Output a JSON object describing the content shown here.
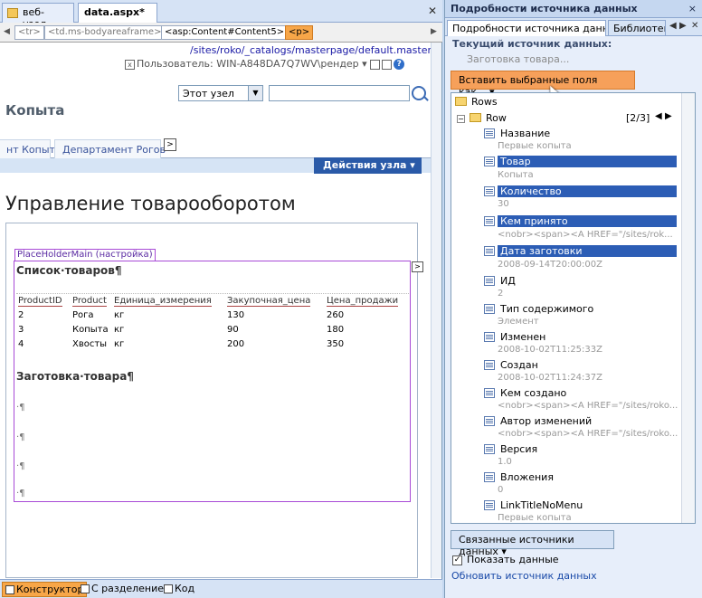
{
  "doc_tabs": [
    {
      "label": "веб-узел",
      "active": false
    },
    {
      "label": "data.aspx*",
      "active": true
    }
  ],
  "tag_bar": {
    "items": [
      "<tr>",
      "<td.ms-bodyareaframe>",
      "<asp:Content#Content5>",
      "<p>"
    ]
  },
  "design": {
    "path": "/sites/roko/_catalogs/masterpage/default.master",
    "user_text": "Пользователь: WIN-A848DA7Q7WV\\рендер ▾",
    "site_title": "Копыта",
    "scope_select": "Этот узел",
    "search_value": "",
    "nav_items": [
      "нт Копыт",
      "Департамент Рогов"
    ],
    "site_actions": "Действия узла ▾",
    "page_title": "Управление товарооборотом",
    "placeholder_label": "PlaceHolderMain (настройка)",
    "list_heading": "Список·товаров¶",
    "table_headers": [
      "ProductID",
      "Product",
      "Единица_измерения",
      "Закупочная_цена",
      "Цена_продажи"
    ],
    "table_rows": [
      [
        "2",
        "Рога",
        "кг",
        "130",
        "260"
      ],
      [
        "3",
        "Копыта",
        "кг",
        "90",
        "180"
      ],
      [
        "4",
        "Хвосты",
        "кг",
        "200",
        "350"
      ]
    ],
    "section_heading": "Заготовка·товара¶",
    "paragraph_marks": [
      "·¶",
      "·¶",
      "·¶",
      "·¶"
    ]
  },
  "view_tabs": [
    {
      "label": "Конструктор",
      "active": true
    },
    {
      "label": "С разделением",
      "active": false
    },
    {
      "label": "Код",
      "active": false
    }
  ],
  "panel": {
    "title": "Подробности источника данных",
    "close": "×",
    "tabs": [
      "Подробности источника данных",
      "Библиотек"
    ],
    "current_label": "Текущий источник данных:",
    "current_value": "Заготовка товара...",
    "insert_button": "Вставить выбранные поля как... ▾",
    "tree": {
      "root": "Rows",
      "row": "Row",
      "row_pager": "[2/3]",
      "fields": [
        {
          "name": "Название",
          "value": "Первые копыта",
          "selected": false
        },
        {
          "name": "Товар",
          "value": "Копыта",
          "selected": true
        },
        {
          "name": "Количество",
          "value": "30",
          "selected": true
        },
        {
          "name": "Кем принято",
          "value": "<nobr><span><A HREF=\"/sites/rok...",
          "selected": true
        },
        {
          "name": "Дата заготовки",
          "value": "2008-09-14T20:00:00Z",
          "selected": true
        },
        {
          "name": "ИД",
          "value": "2",
          "selected": false
        },
        {
          "name": "Тип содержимого",
          "value": "Элемент",
          "selected": false
        },
        {
          "name": "Изменен",
          "value": "2008-10-02T11:25:33Z",
          "selected": false
        },
        {
          "name": "Создан",
          "value": "2008-10-02T11:24:37Z",
          "selected": false
        },
        {
          "name": "Кем создано",
          "value": "<nobr><span><A HREF=\"/sites/roko...",
          "selected": false
        },
        {
          "name": "Автор изменений",
          "value": "<nobr><span><A HREF=\"/sites/roko...",
          "selected": false
        },
        {
          "name": "Версия",
          "value": "1.0",
          "selected": false
        },
        {
          "name": "Вложения",
          "value": "0",
          "selected": false
        },
        {
          "name": "LinkTitleNoMenu",
          "value": "Первые копыта",
          "selected": false
        }
      ]
    },
    "linked_button": "Связанные источники данных ▾",
    "show_data_label": "Показать данные",
    "show_data_checked": true,
    "refresh_link": "Обновить источник данных"
  }
}
